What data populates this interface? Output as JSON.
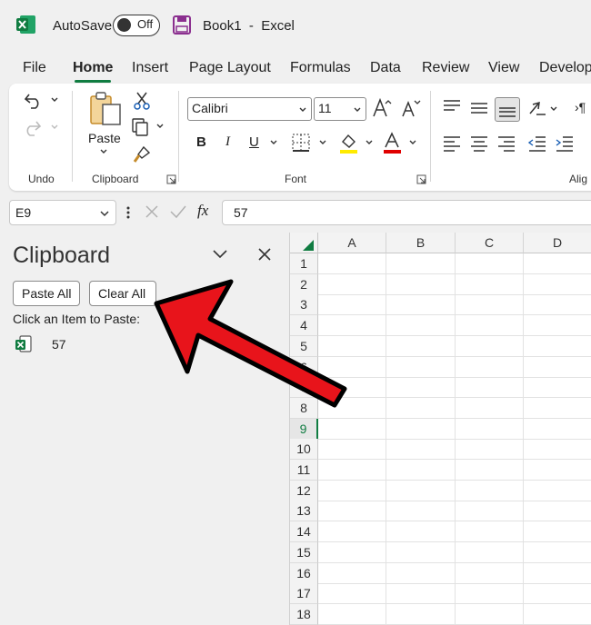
{
  "titlebar": {
    "autosave_label": "AutoSave",
    "toggle_state": "Off",
    "doc_title": "Book1  -  Excel"
  },
  "tabs": [
    "File",
    "Home",
    "Insert",
    "Page Layout",
    "Formulas",
    "Data",
    "Review",
    "View",
    "Develop"
  ],
  "active_tab": "Home",
  "ribbon": {
    "groups": {
      "undo": "Undo",
      "clipboard": "Clipboard",
      "font": "Font",
      "alignment": "Alig"
    },
    "paste_label": "Paste",
    "font_name": "Calibri",
    "font_size": "11",
    "font_buttons": {
      "bold": "B",
      "italic": "I",
      "underline": "U"
    }
  },
  "formula_bar": {
    "name_box": "E9",
    "fx_label": "fx",
    "value": "57"
  },
  "clipboard_pane": {
    "title": "Clipboard",
    "paste_all": "Paste All",
    "clear_all": "Clear All",
    "hint": "Click an Item to Paste:",
    "items": [
      "57"
    ]
  },
  "sheet": {
    "columns": [
      "A",
      "B",
      "C",
      "D"
    ],
    "rows": [
      "1",
      "2",
      "3",
      "4",
      "5",
      "6",
      "7",
      "8",
      "9",
      "10",
      "11",
      "12",
      "13",
      "14",
      "15",
      "16",
      "17",
      "18"
    ],
    "selected_row": "9"
  },
  "colors": {
    "excel_green": "#107c41",
    "arrow_red": "#e8141b"
  }
}
